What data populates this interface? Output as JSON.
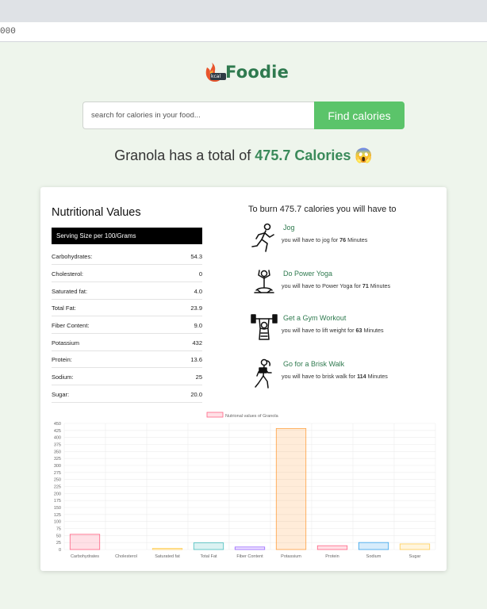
{
  "browser": {
    "url_fragment": "000"
  },
  "logo": {
    "badge": "kcal",
    "name": "Foodie"
  },
  "search": {
    "placeholder": "search for calories in your food...",
    "button_label": "Find calories"
  },
  "headline": {
    "prefix": "Granola has a total of ",
    "calories": "475.7 Calories",
    "emoji": "😱"
  },
  "nutrition": {
    "title": "Nutritional Values",
    "serving": "Serving Size per 100/Grams",
    "rows": [
      {
        "label": "Carbohydrates:",
        "value": "54.3"
      },
      {
        "label": "Cholesterol:",
        "value": "0"
      },
      {
        "label": "Saturated fat:",
        "value": "4.0"
      },
      {
        "label": "Total Fat:",
        "value": "23.9"
      },
      {
        "label": "Fiber Content:",
        "value": "9.0"
      },
      {
        "label": "Potassium",
        "value": "432"
      },
      {
        "label": "Protein:",
        "value": "13.6"
      },
      {
        "label": "Sodium:",
        "value": "25"
      },
      {
        "label": "Sugar:",
        "value": "20.0"
      }
    ]
  },
  "burn": {
    "title": "To burn 475.7 calories you will have to",
    "activities": [
      {
        "name": "Jog",
        "desc_prefix": "you will have to jog for ",
        "minutes": "76",
        "desc_suffix": " Minutes",
        "icon": "jogging-icon"
      },
      {
        "name": "Do Power Yoga",
        "desc_prefix": "you will have to Power Yoga for ",
        "minutes": "71",
        "desc_suffix": " Minutes",
        "icon": "yoga-icon"
      },
      {
        "name": "Get a Gym Workout",
        "desc_prefix": "you will have to lift weight for ",
        "minutes": "63",
        "desc_suffix": " Minutes",
        "icon": "weightlifting-icon"
      },
      {
        "name": "Go for a Brisk Walk",
        "desc_prefix": "you will have to brisk walk for ",
        "minutes": "114",
        "desc_suffix": " Minutes",
        "icon": "walking-icon"
      }
    ]
  },
  "chart_data": {
    "type": "bar",
    "legend": "Nutrional values of Granola",
    "categories": [
      "Carbohydrates",
      "Cholesterol",
      "Saturated fat",
      "Total Fat",
      "Fiber Content",
      "Potassium",
      "Protein",
      "Sodium",
      "Sugar"
    ],
    "values": [
      54.3,
      0,
      4.0,
      23.9,
      9.0,
      432,
      13.6,
      25,
      20.0
    ],
    "ylim": [
      0,
      450
    ],
    "yticks": [
      0,
      25,
      50,
      75,
      100,
      125,
      150,
      175,
      200,
      225,
      250,
      275,
      300,
      325,
      350,
      375,
      400,
      425,
      450
    ],
    "ytick_labels": [
      "0",
      "25",
      "50",
      "75",
      "100",
      "125",
      "150",
      "175",
      "200",
      "225",
      "250",
      "275",
      "300",
      "325",
      "350",
      "375",
      "400",
      "425",
      "450"
    ],
    "colors": [
      "#ff6384",
      "#36a2eb",
      "#ffce56",
      "#4bc0c0",
      "#9966ff",
      "#ff9f40",
      "#ff6384",
      "#36a2eb",
      "#ffce56"
    ],
    "legend_color": "#ff6384",
    "grid": true,
    "legend_position": "top"
  },
  "colors": {
    "accent": "#5bc46a",
    "brand": "#2f7a4f",
    "background": "#eef5ec"
  }
}
